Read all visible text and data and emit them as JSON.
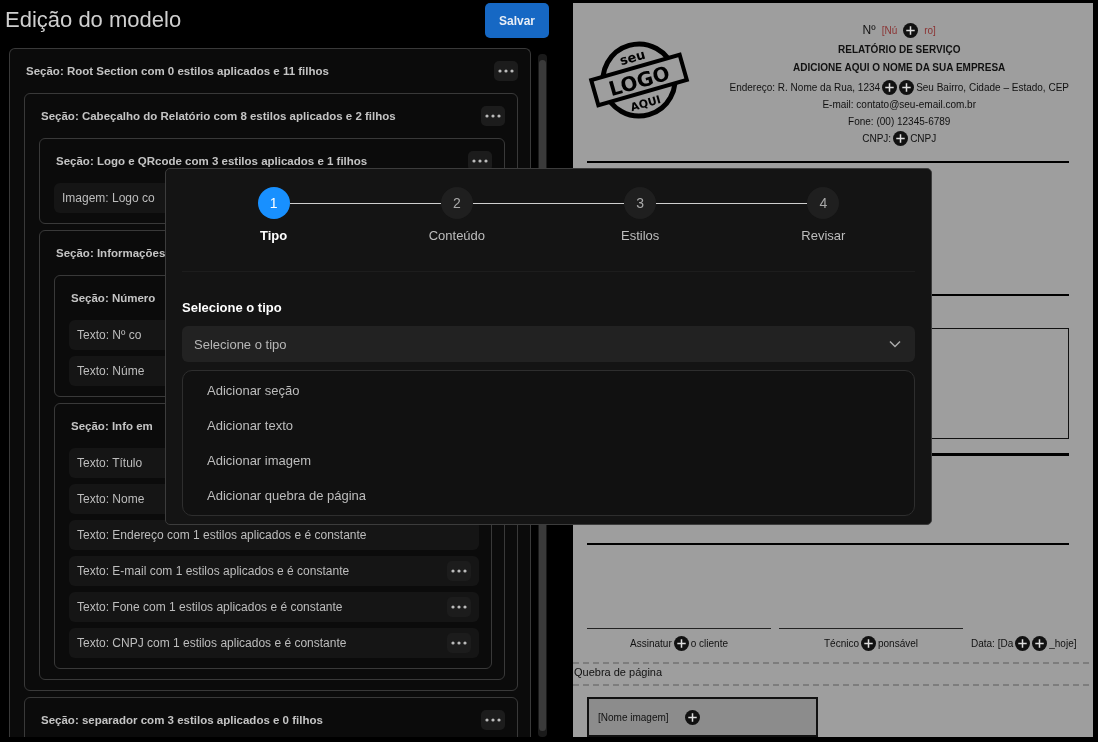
{
  "header": {
    "title": "Edição do modelo",
    "save_button": "Salvar"
  },
  "tree": {
    "kind": "section",
    "label": "Seção: Root Section com 0 estilos aplicados e 11 filhos",
    "menu": true,
    "children": [
      {
        "kind": "section",
        "label": "Seção: Cabeçalho do Relatório com 8 estilos aplicados e 2 filhos",
        "menu": true,
        "children": [
          {
            "kind": "section",
            "label": "Seção: Logo e QRcode com 3 estilos aplicados e 1 filhos",
            "menu": true,
            "children": [
              {
                "kind": "item",
                "label": "Imagem: Logo co"
              }
            ]
          },
          {
            "kind": "section",
            "label": "Seção: Informações",
            "children": [
              {
                "kind": "section",
                "label": "Seção: Número",
                "children": [
                  {
                    "kind": "item",
                    "label": "Texto: Nº co"
                  },
                  {
                    "kind": "item",
                    "label": "Texto: Núme"
                  }
                ]
              },
              {
                "kind": "section",
                "label": "Seção: Info em",
                "children": [
                  {
                    "kind": "item",
                    "label": "Texto: Título"
                  },
                  {
                    "kind": "item",
                    "label": "Texto: Nome"
                  },
                  {
                    "kind": "item",
                    "label": "Texto: Endereço com 1 estilos aplicados e é constante"
                  },
                  {
                    "kind": "item",
                    "label": "Texto: E-mail com 1 estilos aplicados e é constante",
                    "menu": true
                  },
                  {
                    "kind": "item",
                    "label": "Texto: Fone com 1 estilos aplicados e é constante",
                    "menu": true
                  },
                  {
                    "kind": "item",
                    "label": "Texto: CNPJ com 1 estilos aplicados e é constante",
                    "menu": true
                  }
                ]
              }
            ]
          }
        ]
      },
      {
        "kind": "section",
        "label": "Seção: separador com 3 estilos aplicados e 0 filhos",
        "menu": true
      }
    ]
  },
  "preview": {
    "logo": {
      "top": "seu",
      "middle": "LOGO",
      "bottom": "AQUI"
    },
    "number_line": [
      {
        "kind": "text",
        "text": "Nº"
      },
      {
        "kind": "placeholder",
        "text": "[Nú"
      },
      {
        "kind": "plus"
      },
      {
        "kind": "placeholder",
        "text": "ro]"
      }
    ],
    "title": "RELATÓRIO DE SERVIÇO",
    "company": "ADICIONE AQUI O NOME DA SUA EMPRESA",
    "address_line": [
      {
        "kind": "text",
        "text": "Endereço: R. Nome da Rua, 1234"
      },
      {
        "kind": "plus"
      },
      {
        "kind": "plus"
      },
      {
        "kind": "text",
        "text": "Seu Bairro, Cidade – Estado, CEP"
      }
    ],
    "email": "E-mail: contato@seu-email.com.br",
    "phone": "Fone: (00) 12345-6789",
    "cnpj_line": [
      {
        "kind": "text",
        "text": "CNPJ:"
      },
      {
        "kind": "plus"
      },
      {
        "kind": "text",
        "text": "CNPJ"
      }
    ],
    "signatures": [
      [
        {
          "kind": "text",
          "text": "Assinatur"
        },
        {
          "kind": "plus"
        },
        {
          "kind": "text",
          "text": "o cliente"
        }
      ],
      [
        {
          "kind": "text",
          "text": "Técnico"
        },
        {
          "kind": "plus"
        },
        {
          "kind": "text",
          "text": "ponsável"
        }
      ],
      [
        {
          "kind": "text",
          "text": "Data: [Da"
        },
        {
          "kind": "plus"
        },
        {
          "kind": "plus"
        },
        {
          "kind": "text",
          "text": "_hoje]"
        }
      ]
    ],
    "page_break": "Quebra de página",
    "image_line": [
      {
        "kind": "text",
        "text": "[Nome imagem]"
      },
      {
        "kind": "plus"
      }
    ]
  },
  "dialog": {
    "steps": [
      {
        "number": "1",
        "label": "Tipo",
        "selected": true
      },
      {
        "number": "2",
        "label": "Conteúdo",
        "selected": false
      },
      {
        "number": "3",
        "label": "Estilos",
        "selected": false
      },
      {
        "number": "4",
        "label": "Revisar",
        "selected": false
      }
    ],
    "field_label": "Selecione o tipo",
    "select": {
      "placeholder": "Selecione o tipo"
    },
    "options": [
      "Adicionar seção",
      "Adicionar texto",
      "Adicionar imagem",
      "Adicionar quebra de página"
    ]
  }
}
